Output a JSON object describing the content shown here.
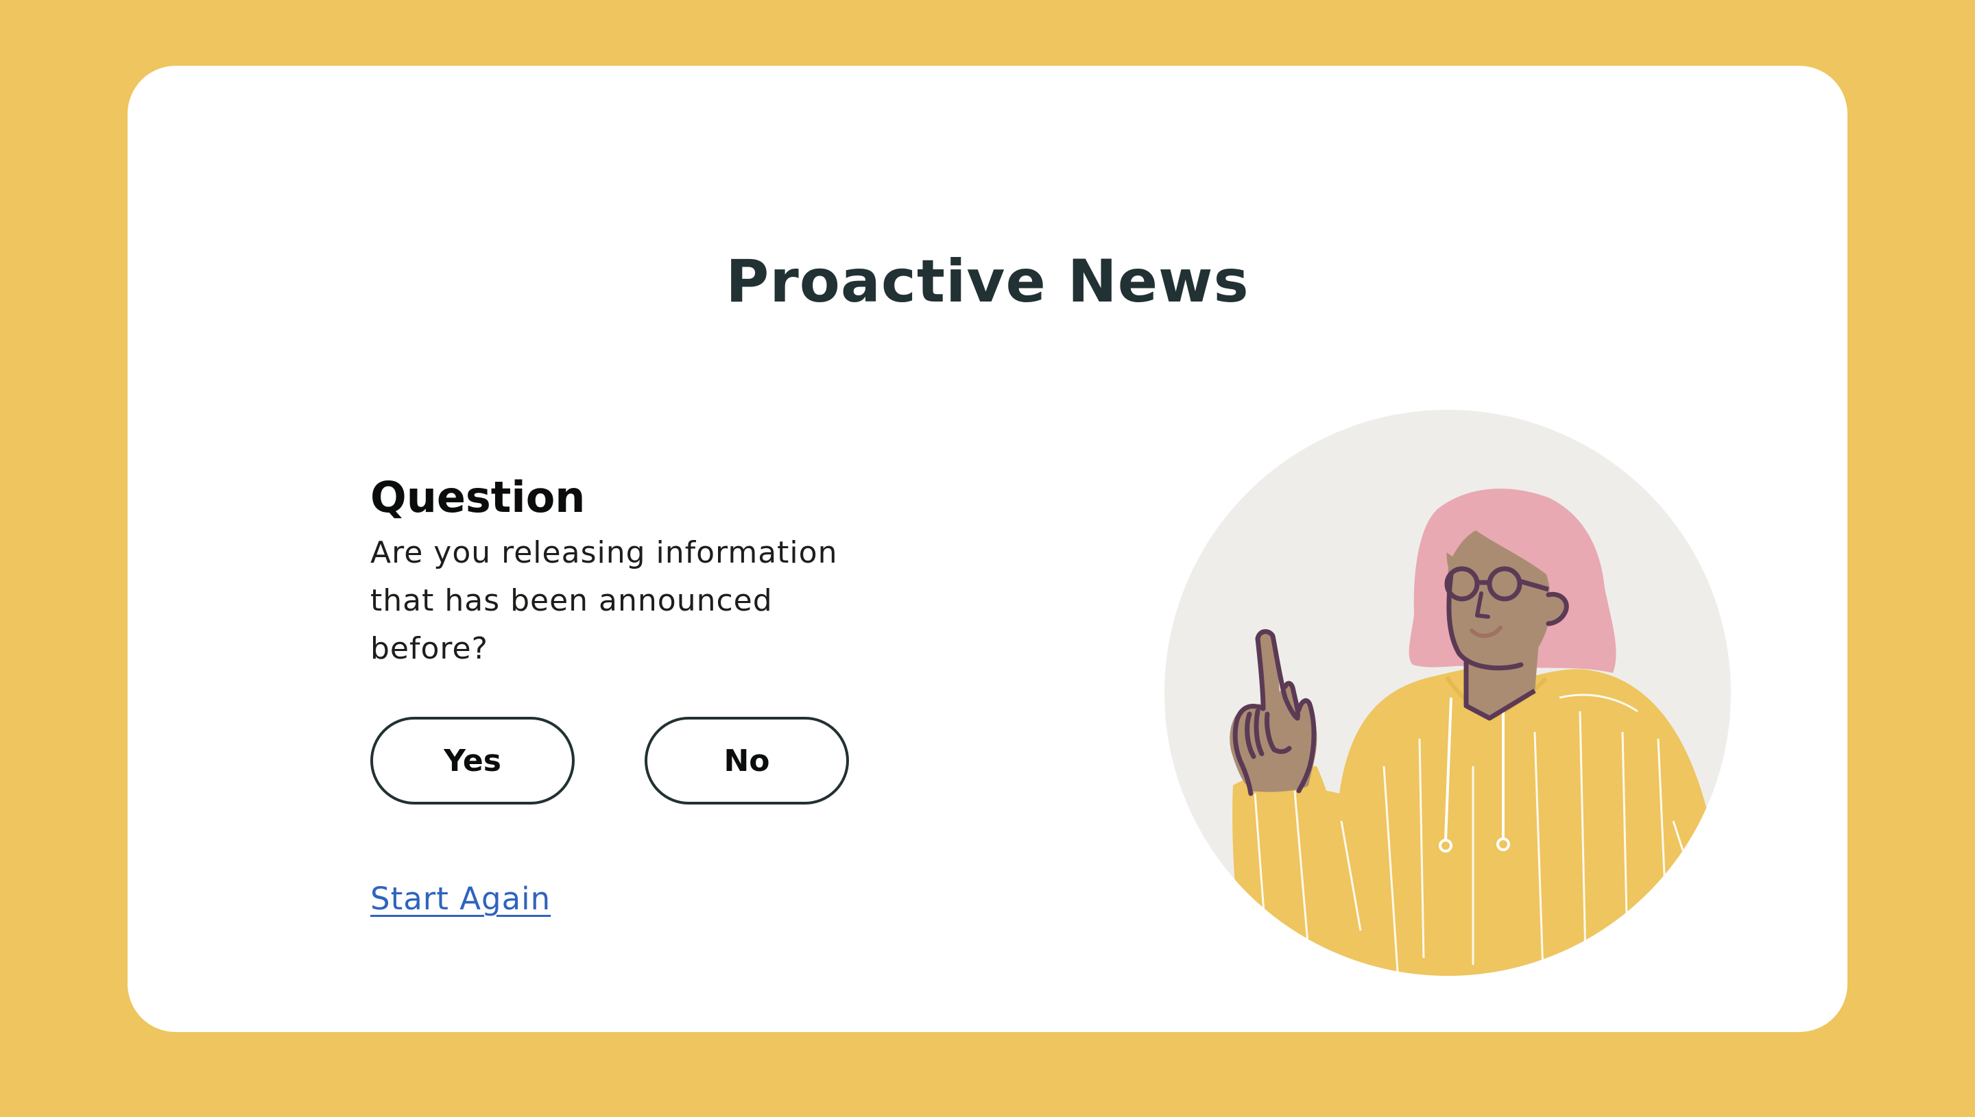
{
  "page": {
    "title": "Proactive News"
  },
  "question": {
    "heading": "Question",
    "text": "Are you releasing information that has been announced before?"
  },
  "answers": {
    "yes_label": "Yes",
    "no_label": "No"
  },
  "links": {
    "start_again": "Start Again"
  },
  "illustration": {
    "subject": "person-pointing-up-illustration"
  },
  "colors": {
    "background": "#EEC55E",
    "card": "#FFFFFF",
    "title_text": "#223133",
    "button_border": "#223133",
    "link": "#2F63BE",
    "illustration_circle": "#EEEDEA",
    "hoodie": "#EEC55E",
    "hair": "#E8A9B2",
    "skin": "#AA8C73",
    "outline": "#5B3A55"
  }
}
